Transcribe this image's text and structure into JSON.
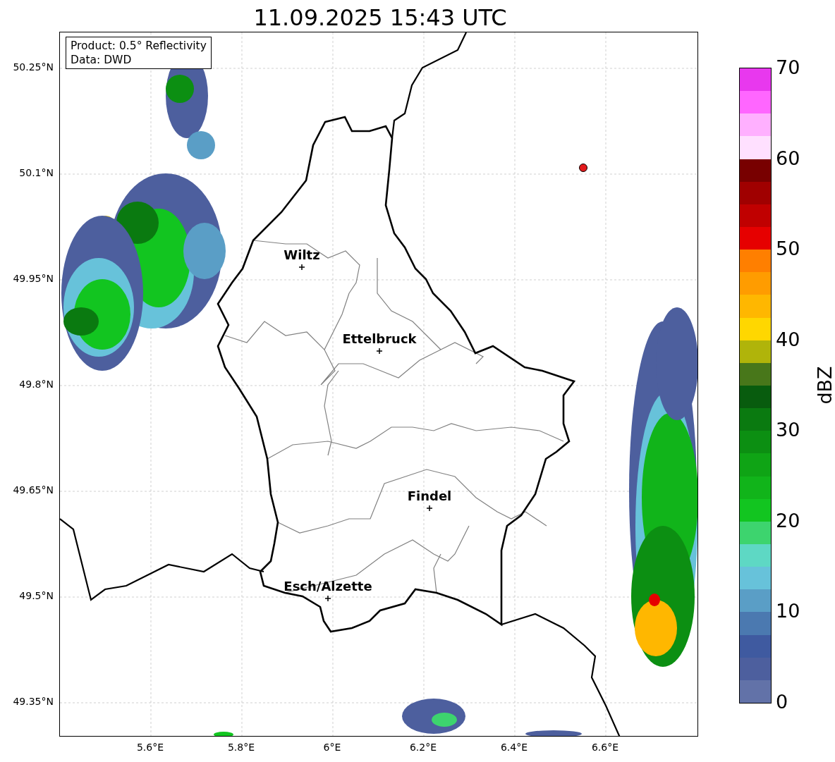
{
  "title": "11.09.2025 15:43 UTC",
  "info_box": {
    "lines": [
      "Product: 0.5° Reflectivity",
      "Data: DWD"
    ]
  },
  "map": {
    "lat_labels": [
      "50.25°N",
      "50.1°N",
      "49.95°N",
      "49.8°N",
      "49.65°N",
      "49.5°N",
      "49.35°N"
    ],
    "lon_labels": [
      "5.6°E",
      "5.8°E",
      "6°E",
      "6.2°E",
      "6.4°E",
      "6.6°E"
    ],
    "places": [
      {
        "name": "Wiltz"
      },
      {
        "name": "Ettelbruck"
      },
      {
        "name": "Findel"
      },
      {
        "name": "Esch/Alzette"
      }
    ]
  },
  "colorbar": {
    "label": "dBZ",
    "ticks": [
      "70",
      "60",
      "50",
      "40",
      "30",
      "20",
      "10",
      "0"
    ],
    "bands": [
      {
        "color": "#e838ee"
      },
      {
        "color": "#ff66ff"
      },
      {
        "color": "#ffb0ff"
      },
      {
        "color": "#ffe0ff"
      },
      {
        "color": "#780000"
      },
      {
        "color": "#a00000"
      },
      {
        "color": "#c00000"
      },
      {
        "color": "#e60000"
      },
      {
        "color": "#ff7f00"
      },
      {
        "color": "#ff9c00"
      },
      {
        "color": "#ffb700"
      },
      {
        "color": "#ffd700"
      },
      {
        "color": "#b0b40a"
      },
      {
        "color": "#48771a"
      },
      {
        "color": "#085c0e"
      },
      {
        "color": "#0a7a10"
      },
      {
        "color": "#0c8f12"
      },
      {
        "color": "#0fa415"
      },
      {
        "color": "#11b41a"
      },
      {
        "color": "#12c520"
      },
      {
        "color": "#3dd46e"
      },
      {
        "color": "#5ed8c4"
      },
      {
        "color": "#67c2da"
      },
      {
        "color": "#5a9ec6"
      },
      {
        "color": "#4b79b0"
      },
      {
        "color": "#3f5aa0"
      },
      {
        "color": "#4d5f9e"
      },
      {
        "color": "#6272a8"
      }
    ]
  }
}
